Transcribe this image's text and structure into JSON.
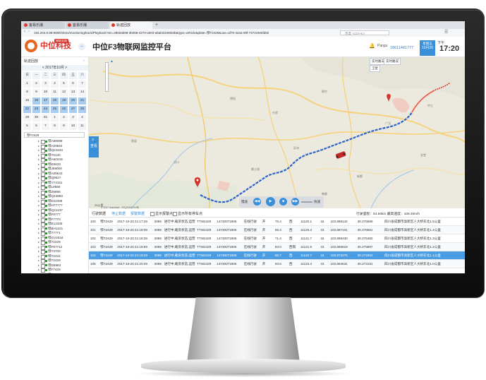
{
  "browser": {
    "tabs": [
      {
        "label": "客易乐播"
      },
      {
        "label": "客易乐播"
      },
      {
        "label": "轨迹回放"
      }
    ],
    "url": "192.204.8.98:8080/vbms/monitoring/track/Playback?vin=4850ab98-3b058-4270-a003-a5ab33c8083b&type=vehicle&plate=鄂T2429&use=af70-4a4a-99f-7474c9e5fd50",
    "search_placeholder": "百度 <Ctrl+K>"
  },
  "header": {
    "logo_text": "中位科技",
    "logo_badge": "物联实践",
    "app_title": "中位F3物联网监控平台",
    "user": "Pangu",
    "phone": "18611481777",
    "date_line1": "星期五",
    "date_line2": "10月20",
    "weekday": "下午",
    "time": "17:20"
  },
  "left_panel": {
    "title": "轨迹回放",
    "calendar_header": "< 2017年10月 >",
    "weekdays": [
      "日",
      "一",
      "二",
      "三",
      "四",
      "五",
      "六"
    ],
    "days": [
      [
        "1",
        "2",
        "3",
        "4",
        "5",
        "6",
        "7"
      ],
      [
        "8",
        "9",
        "10",
        "11",
        "12",
        "13",
        "14"
      ],
      [
        "15",
        "16",
        "17",
        "18",
        "19",
        "20",
        "21"
      ],
      [
        "22",
        "23",
        "24",
        "25",
        "26",
        "27",
        "28"
      ],
      [
        "29",
        "30",
        "31",
        "1",
        "2",
        "3",
        "4"
      ],
      [
        "5",
        "6",
        "7",
        "8",
        "9",
        "10",
        "11"
      ]
    ],
    "search_value": "鄂T2429",
    "vehicles": [
      "鄂A88089",
      "鄂A09564",
      "鄂Q21933",
      "鄂T6130",
      "鄂A6034S",
      "鄂E5633",
      "鄂J59009",
      "鄂A09643",
      "鄂Q9627",
      "鄂Y74151",
      "鄂L8898",
      "鄂Z9888",
      "鄂Q44883",
      "鄂D11089",
      "鄂H77777",
      "鄂Q21237",
      "鄂F9777",
      "鄂F7770",
      "鄂E12345",
      "鄂BH1221",
      "鄂T7771",
      "鄂GV2034",
      "鄂T2429",
      "鄂F87712",
      "鄂T3700",
      "鄂T2434",
      "鄂T2429",
      "鄂D9883",
      "鄂F7429",
      "鄂KC7206",
      "鄂T2428",
      "鄂A7153",
      "鄂A12345",
      "鄂Y1234",
      "鄂F7777",
      "鄂T7777"
    ]
  },
  "map": {
    "layer_label": "▲",
    "tools": [
      "实时路况",
      "卫星",
      "实时路况"
    ],
    "float_button": "查看",
    "scale": "20公里",
    "copyright": "© 2017 AutoNavi - GS(2016)710号",
    "player": {
      "speed_left": "慢速",
      "speed_right": "快速"
    }
  },
  "bottom": {
    "tabs": [
      "行驶数据",
      "停止数据",
      "报警数据"
    ],
    "check1": "显示报警点",
    "check2": "显示所有停车点",
    "stats": "行驶里程：54.50km      最高速度：109.4km/h",
    "rows": [
      [
        "100",
        "鄂T2429",
        "2017-10-20 21:17:29",
        "3089",
        "进行中,载货状态,运营中",
        "TTW2429",
        "14730071806",
        "在线行驶",
        "开",
        "70.4",
        "西",
        "11120.1",
        "15",
        "103.698142",
        "30.276586",
        "四川省成都市高新区人大桥东北1.5公里"
      ],
      [
        "101",
        "鄂T2429",
        "2017-10-20 21:18:09",
        "3089",
        "进行中,载货状态,运营中",
        "TTW2429",
        "14730071806",
        "在线行驶",
        "开",
        "65.4",
        "西",
        "11120.4",
        "15",
        "103.697101",
        "30.276581",
        "四川省成都市高新区人大桥东北1.4公里"
      ],
      [
        "102",
        "鄂T2429",
        "2017-10-20 21:18:29",
        "3089",
        "进行中,载货状态,运营中",
        "TTW2429",
        "14730071806",
        "在线行驶",
        "开",
        "71.4",
        "西",
        "11121.7",
        "15",
        "103.696430",
        "30.276482",
        "四川省成都市高新区人大桥东北1.3公里"
      ],
      [
        "103",
        "鄂T2429",
        "2017-10-20 21:18:59",
        "3089",
        "进行中,载货状态,运营中",
        "TTW2429",
        "14730071806",
        "在线行驶",
        "开",
        "83.0",
        "西南",
        "11121.9",
        "15",
        "103.695819",
        "30.275897",
        "四川省成都市高新区人大桥东北1.2公里"
      ],
      [
        "104",
        "鄂T2429",
        "2017-10-20 21:19:29",
        "3089",
        "进行中,载货状态,运营中",
        "TTW2429",
        "14730071806",
        "在线行驶",
        "开",
        "86.7",
        "西",
        "11122.7",
        "15",
        "103.873275",
        "30.273304",
        "四川省成都市高新区人大桥东北1.1公里"
      ],
      [
        "105",
        "鄂T2429",
        "2017-10-20 21:20:29",
        "3089",
        "进行中,载货状态,运营中",
        "TTW2429",
        "14730071806",
        "在线行驶",
        "开",
        "93.5",
        "西",
        "11123.4",
        "15",
        "103.694631",
        "30.273191",
        "四川省成都市高新区人大桥东北1.0公里"
      ]
    ],
    "selected_row": 4
  },
  "colors": {
    "accent": "#3a8fd9",
    "brand": "#d4332a",
    "route": "#2d63c8"
  }
}
